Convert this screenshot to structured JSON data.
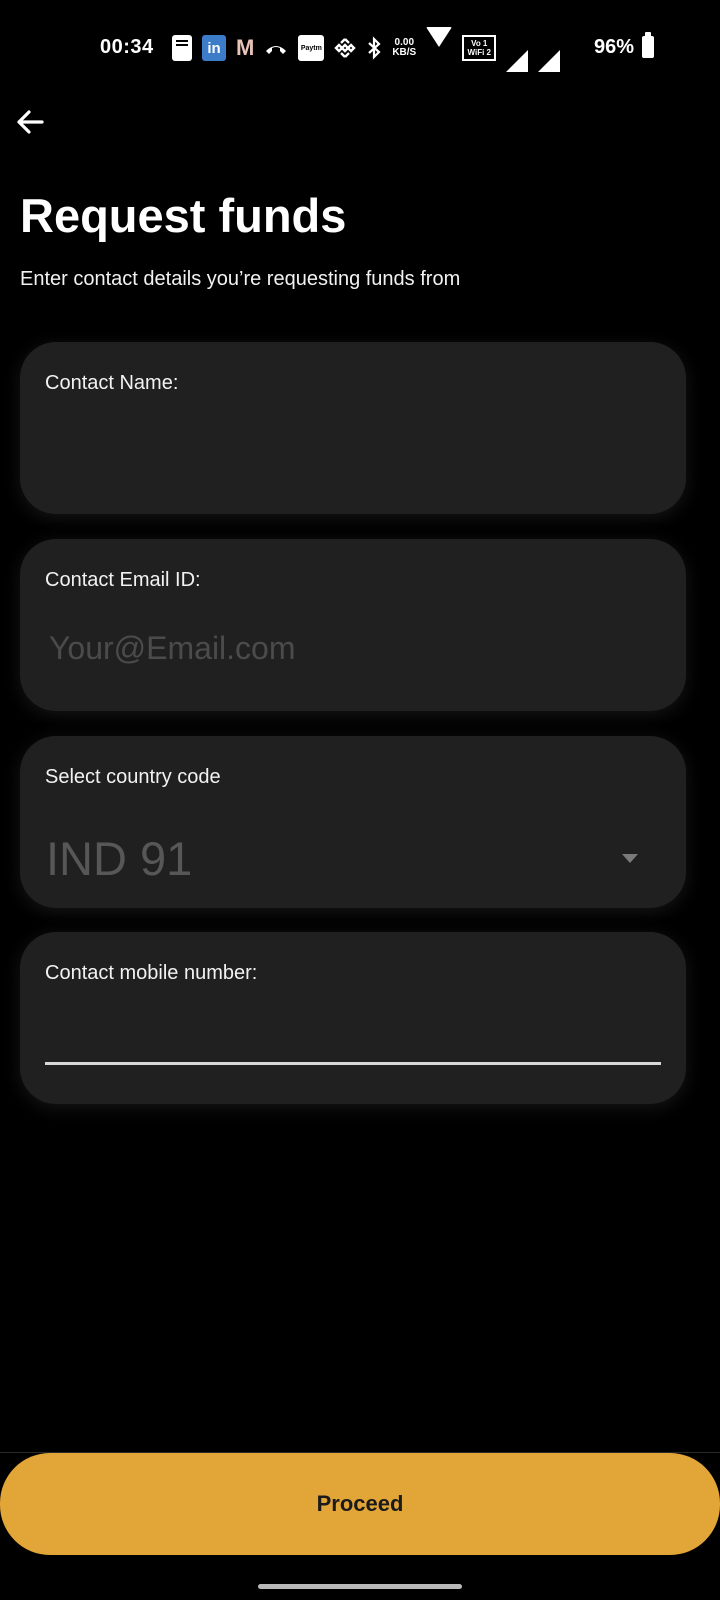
{
  "status_bar": {
    "time": "00:34",
    "linkedin_glyph": "in",
    "gmail_glyph": "M",
    "paytm_glyph": "Paytm",
    "speed_value": "0.00",
    "speed_unit": "KB/S",
    "vowifi_line1": "Vo 1",
    "vowifi_line2": "WiFi 2",
    "battery": "96%",
    "icons": [
      "message-icon",
      "linkedin-icon",
      "gmail-icon",
      "call-icon",
      "paytm-icon",
      "binance-icon",
      "bluetooth-icon",
      "network-speed",
      "wifi-icon",
      "vowifi-icon",
      "signal-icon",
      "signal-icon",
      "battery-icon"
    ]
  },
  "header": {
    "back_icon": "arrow-left-icon",
    "title": "Request funds",
    "subtitle": "Enter contact details you’re requesting funds from"
  },
  "form": {
    "contact_name": {
      "label": "Contact Name:",
      "value": "",
      "placeholder": ""
    },
    "contact_email": {
      "label": "Contact Email ID:",
      "value": "",
      "placeholder": "Your@Email.com"
    },
    "country_code": {
      "label": "Select country code",
      "selected": "IND 91",
      "icon": "dropdown-arrow-icon"
    },
    "mobile_number": {
      "label": "Contact mobile number:",
      "value": ""
    }
  },
  "footer": {
    "proceed_label": "Proceed"
  },
  "colors": {
    "background": "#000000",
    "card": "#202020",
    "accent": "#e2a638",
    "placeholder": "#4b4b4b"
  }
}
